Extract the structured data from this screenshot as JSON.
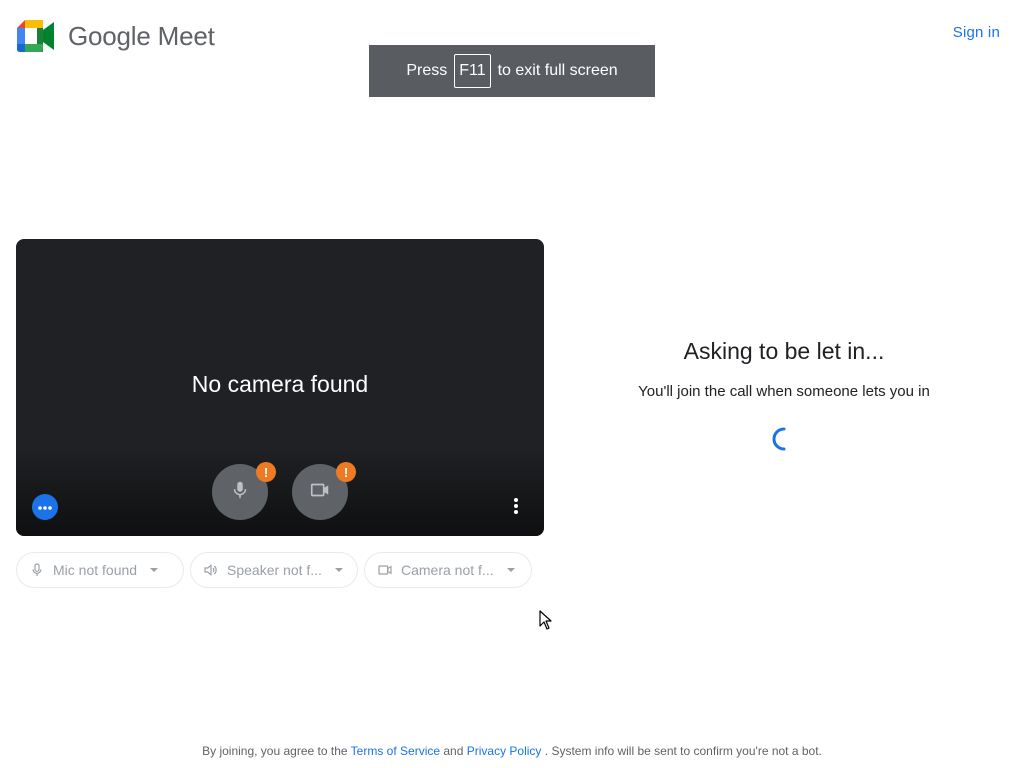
{
  "header": {
    "brand": "Google Meet",
    "sign_in_label": "Sign in"
  },
  "fullscreen_toast": {
    "before": "Press",
    "key": "F11",
    "after": "to exit full screen"
  },
  "preview": {
    "message": "No camera found",
    "mic_badge": "!",
    "camera_badge": "!"
  },
  "devices": {
    "mic": "Mic not found",
    "speaker": "Speaker not f...",
    "camera": "Camera not f..."
  },
  "ask": {
    "title": "Asking to be let in...",
    "subtitle": "You'll join the call when someone lets you in"
  },
  "footer": {
    "prefix": "By joining, you agree to the",
    "terms": "Terms of Service",
    "and": "and",
    "privacy": "Privacy Policy",
    "suffix": ". System info will be sent to confirm you're not a bot."
  },
  "colors": {
    "accent": "#1a73e8",
    "warning": "#ee7b24",
    "preview_bg": "#202124",
    "button_gray": "#5f6368",
    "toast_bg": "#595c60"
  },
  "icons": [
    "meet-logo-icon",
    "mic-icon",
    "camera-icon",
    "warning-icon",
    "effects-icon",
    "more-vert-icon",
    "speaker-icon",
    "caret-down-icon",
    "spinner-icon",
    "mouse-cursor-icon"
  ]
}
